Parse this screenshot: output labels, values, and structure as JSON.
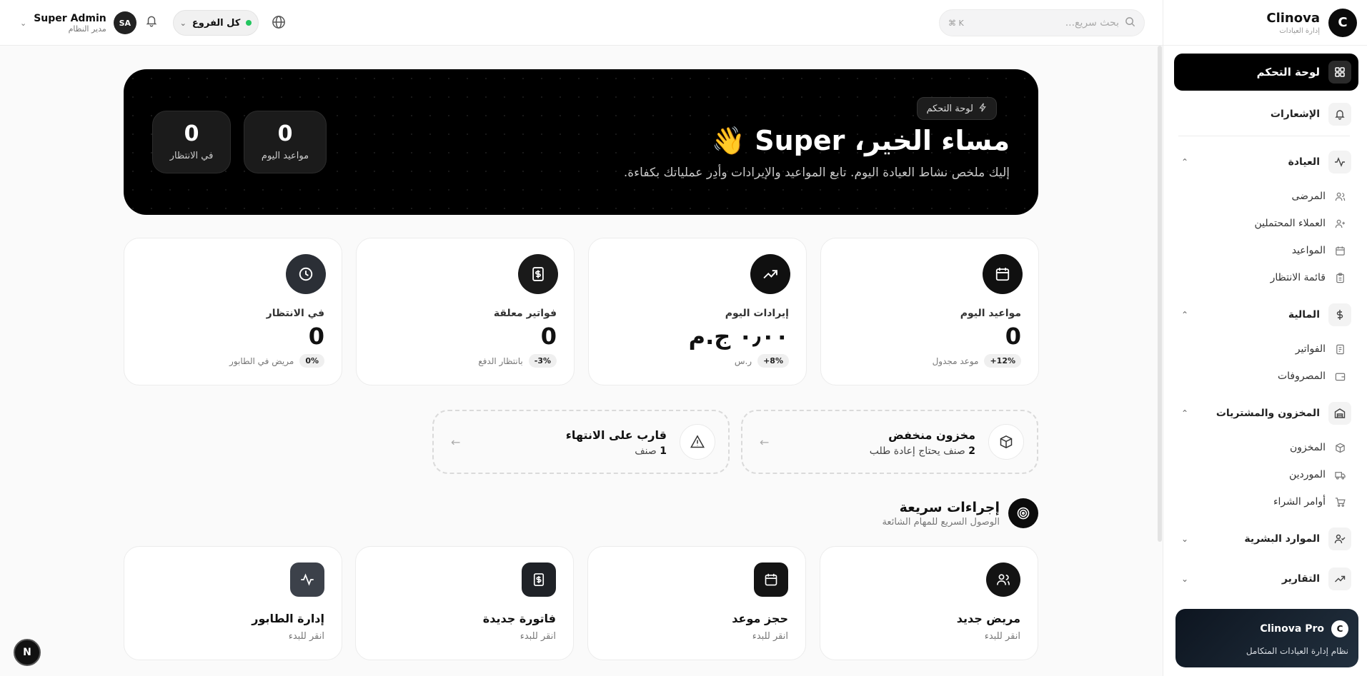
{
  "brand": {
    "logo": "C",
    "name": "Clinova",
    "subtitle": "إدارة العيادات"
  },
  "header": {
    "search_placeholder": "بحث سريع...",
    "search_shortcut": "⌘ K",
    "branch_label": "كل الفروع",
    "user": {
      "name": "Super Admin",
      "role": "مدير النظام",
      "initials": "SA"
    }
  },
  "sidebar": {
    "dashboard": "لوحة التحكم",
    "notifications": "الإشعارات",
    "sections": [
      {
        "label": "العيادة",
        "items": [
          "المرضى",
          "العملاء المحتملين",
          "المواعيد",
          "قائمة الانتظار"
        ]
      },
      {
        "label": "المالية",
        "items": [
          "الفواتير",
          "المصروفات"
        ]
      },
      {
        "label": "المخزون والمشتريات",
        "items": [
          "المخزون",
          "الموردين",
          "أوامر الشراء"
        ]
      },
      {
        "label": "الموارد البشرية",
        "items": []
      },
      {
        "label": "التقارير",
        "items": []
      }
    ],
    "pro": {
      "logo": "C",
      "title": "Clinova Pro",
      "subtitle": "نظام إدارة العيادات المتكامل"
    }
  },
  "hero": {
    "badge": "لوحة التحكم",
    "greeting": "مساء الخير، Super 👋",
    "subtitle": "إليك ملخص نشاط العيادة اليوم. تابع المواعيد والإيرادات وأدِر عملياتك بكفاءة.",
    "stats": [
      {
        "value": "0",
        "label": "مواعيد اليوم"
      },
      {
        "value": "0",
        "label": "في الانتظار"
      }
    ]
  },
  "stats": [
    {
      "label": "مواعيد اليوم",
      "value": "0",
      "badge": "+12%",
      "caption": "موعد مجدول",
      "icon": "calendar-icon"
    },
    {
      "label": "إيرادات اليوم",
      "value": "٠٫٠٠ ج.م",
      "badge": "+8%",
      "caption": "ر.س",
      "icon": "trending-up-icon"
    },
    {
      "label": "فواتير معلقة",
      "value": "0",
      "badge": "-3%",
      "caption": "بانتظار الدفع",
      "icon": "receipt-icon"
    },
    {
      "label": "في الانتظار",
      "value": "0",
      "badge": "0%",
      "caption": "مريض في الطابور",
      "icon": "clock-icon"
    }
  ],
  "alerts": [
    {
      "title": "مخزون منخفض",
      "count": "2",
      "sub": "صنف يحتاج إعادة طلب",
      "icon": "box-icon"
    },
    {
      "title": "قارب على الانتهاء",
      "count": "1",
      "sub": "صنف",
      "icon": "warning-icon"
    }
  ],
  "quick_actions": {
    "title": "إجراءات سريعة",
    "subtitle": "الوصول السريع للمهام الشائعة",
    "items": [
      {
        "title": "مريض جديد",
        "sub": "انقر للبدء",
        "icon": "users-icon"
      },
      {
        "title": "حجز موعد",
        "sub": "انقر للبدء",
        "icon": "calendar-icon"
      },
      {
        "title": "فاتورة جديدة",
        "sub": "انقر للبدء",
        "icon": "receipt-icon"
      },
      {
        "title": "إدارة الطابور",
        "sub": "انقر للبدء",
        "icon": "activity-icon"
      }
    ]
  },
  "dev_badge": "N"
}
